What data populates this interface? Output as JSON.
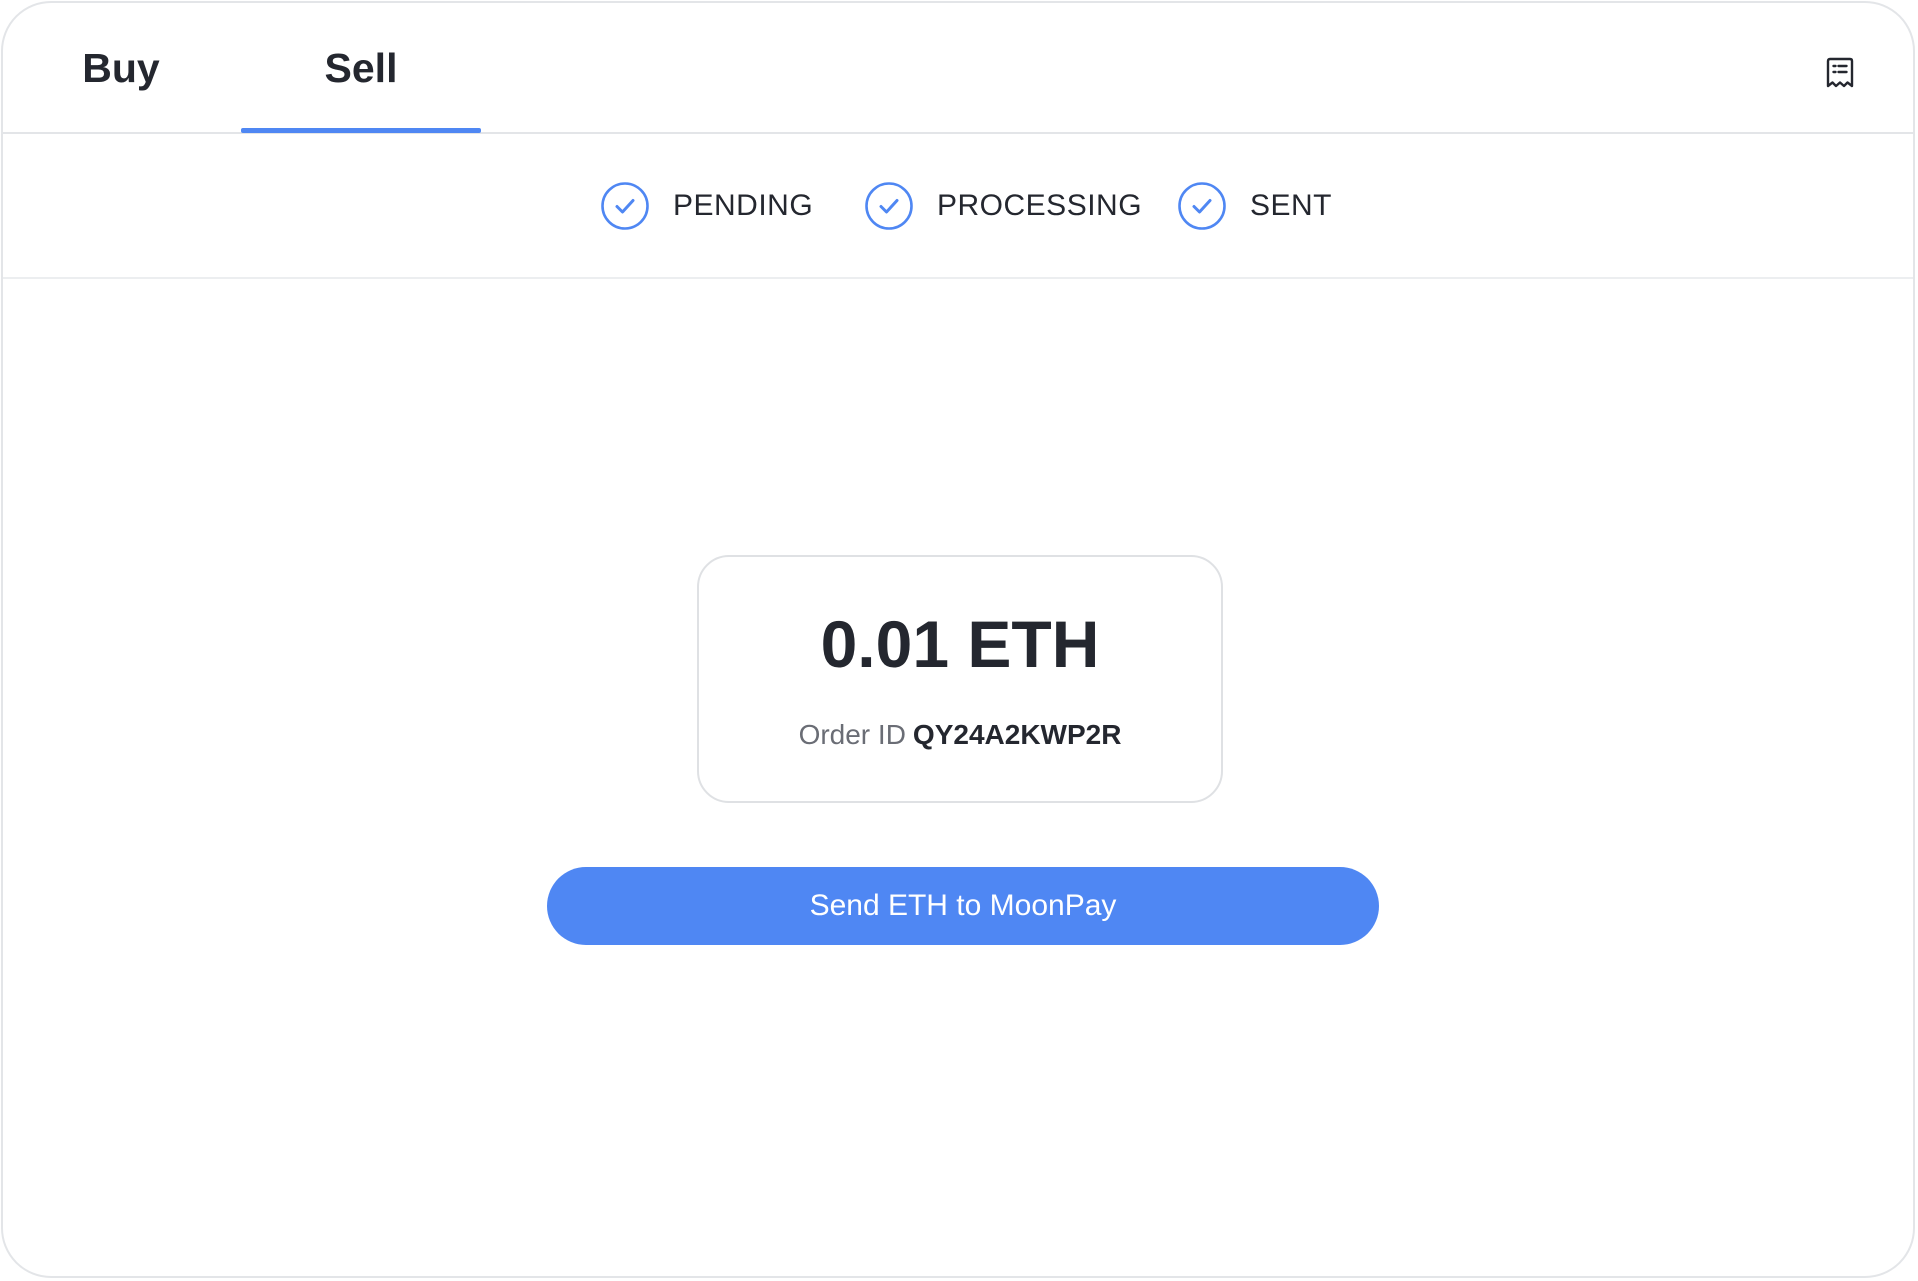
{
  "tabs": [
    {
      "label": "Buy"
    },
    {
      "label": "Sell"
    }
  ],
  "header": {
    "receipt_icon": "receipt-icon"
  },
  "steps": [
    {
      "label": "PENDING",
      "icon": "check-circle-icon"
    },
    {
      "label": "PROCESSING",
      "icon": "check-circle-icon"
    },
    {
      "label": "SENT",
      "icon": "check-circle-icon"
    }
  ],
  "order": {
    "amount": "0.01 ETH",
    "id_label": "Order ID",
    "id_value": "QY24A2KWP2R"
  },
  "send_button_label": "Send ETH to MoonPay",
  "colors": {
    "accent": "#4f87f3",
    "text": "#24272f",
    "muted": "#6a6d75",
    "border": "#e3e5e8"
  }
}
